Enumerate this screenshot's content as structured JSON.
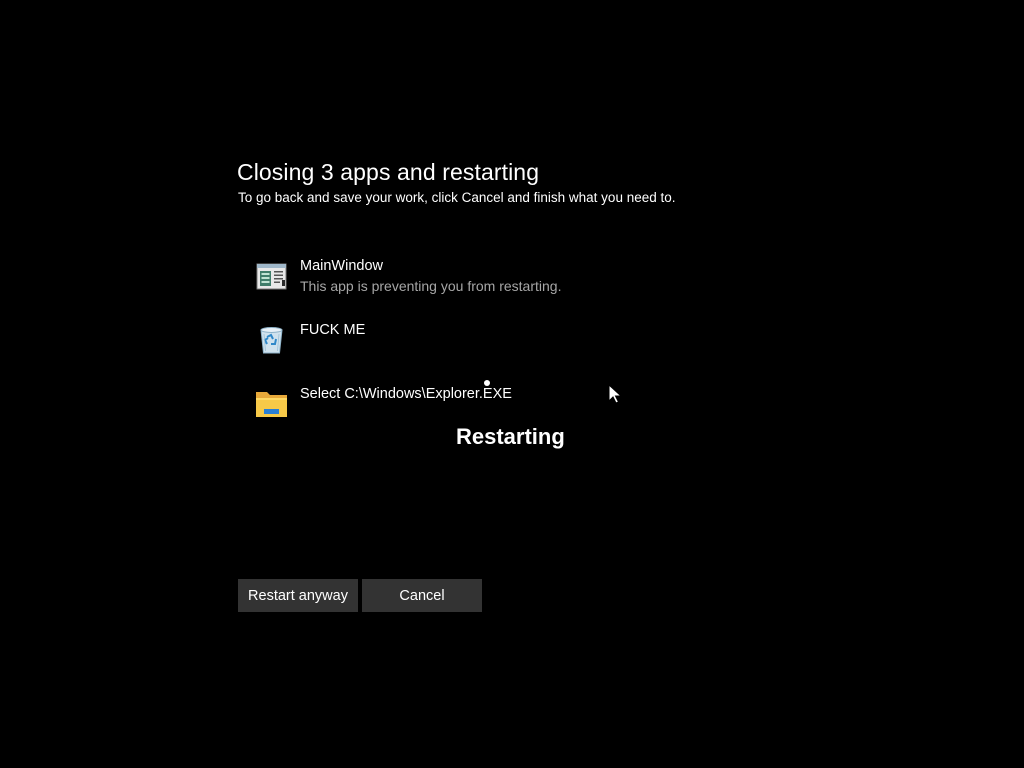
{
  "dialog": {
    "title": "Closing 3 apps and restarting",
    "subtitle": "To go back and save your work, click Cancel and finish what you need to."
  },
  "apps": [
    {
      "name": "MainWindow",
      "description": "This app is preventing you from restarting.",
      "icon": "app-window-icon"
    },
    {
      "name": "FUCK ME",
      "description": "",
      "icon": "recycle-bin-icon"
    },
    {
      "name": "Select C:\\Windows\\Explorer.EXE",
      "description": "",
      "icon": "folder-icon"
    }
  ],
  "status": "Restarting",
  "buttons": {
    "restart_anyway": "Restart anyway",
    "cancel": "Cancel"
  },
  "colors": {
    "background": "#000000",
    "button_bg": "#333333",
    "secondary_text": "#a6a6a6",
    "folder": "#f7c948"
  }
}
